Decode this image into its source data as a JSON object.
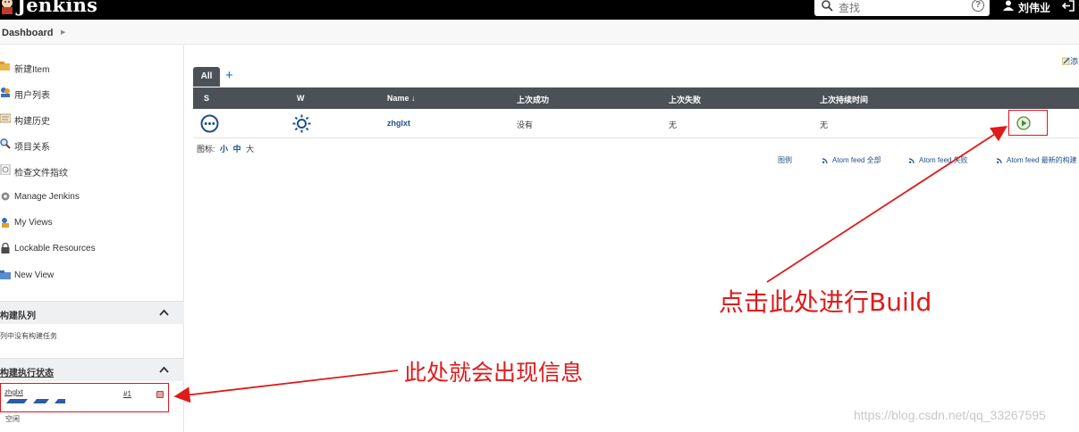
{
  "header": {
    "brand": "Jenkins",
    "search_placeholder": "查找",
    "help_glyph": "?",
    "username": "刘伟业"
  },
  "breadcrumb": {
    "item": "Dashboard"
  },
  "sidebar": {
    "tasks": [
      {
        "label": "新建Item",
        "icon": "new-item-icon"
      },
      {
        "label": "用户列表",
        "icon": "people-icon"
      },
      {
        "label": "构建历史",
        "icon": "build-history-icon"
      },
      {
        "label": "项目关系",
        "icon": "search-icon"
      },
      {
        "label": "检查文件指纹",
        "icon": "fingerprint-icon"
      },
      {
        "label": "Manage Jenkins",
        "icon": "gear-icon"
      },
      {
        "label": "My Views",
        "icon": "user-views-icon"
      },
      {
        "label": "Lockable Resources",
        "icon": "lock-icon"
      },
      {
        "label": "New View",
        "icon": "folder-icon"
      }
    ],
    "build_queue": {
      "title": "构建队列",
      "empty_text": "列中没有构建任务"
    },
    "executors": {
      "title": "构建执行状态",
      "job": "zhglxt",
      "build_number": "#1",
      "idle": "空闲"
    }
  },
  "main": {
    "add_description": "添",
    "tabs": [
      {
        "label": "All"
      }
    ],
    "add_tab_glyph": "+",
    "columns": [
      "S",
      "W",
      "Name ↓",
      "上次成功",
      "上次失败",
      "上次持续时间"
    ],
    "rows": [
      {
        "status": "not-built",
        "weather": "sunny",
        "name": "zhglxt",
        "last_success": "没有",
        "last_failure": "无",
        "last_duration": "无"
      }
    ],
    "icon_size": {
      "label": "图标:",
      "small": "小",
      "medium": "中",
      "large": "大"
    },
    "footer_links": [
      "图例",
      "Atom feed 全部",
      "Atom feed 失败",
      "Atom feed 最新的构建"
    ]
  },
  "annotations": {
    "build_hint": "点击此处进行Build",
    "info_hint": "此处就会出现信息"
  },
  "watermark": "https://blog.csdn.net/qq_33267595",
  "colors": {
    "topbar": "#000000",
    "table_header": "#4b5157",
    "link": "#1f4e8c",
    "annotation_red": "#e01a1a"
  }
}
